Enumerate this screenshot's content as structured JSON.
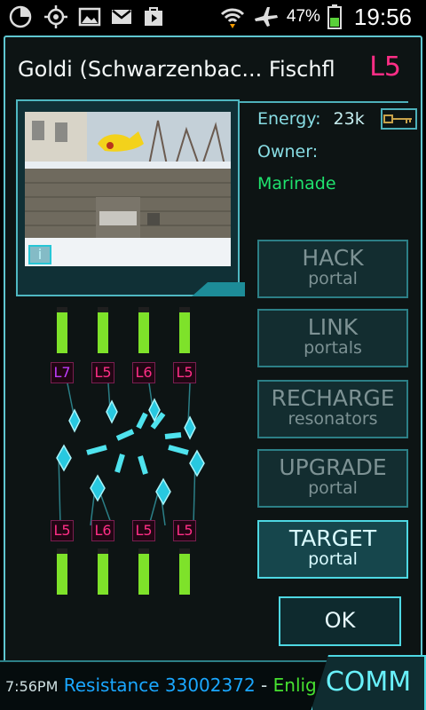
{
  "statusbar": {
    "battery_percent": "47%",
    "time": "19:56",
    "left_icons": [
      "pie-chart-icon",
      "crosshair-icon",
      "gallery-icon",
      "gmail-icon",
      "play-store-icon"
    ],
    "right_icons": [
      "wifi-icon",
      "airplane-icon",
      "battery-icon"
    ]
  },
  "portal": {
    "title": "Goldi (Schwarzenbac... Fischfl",
    "level": "L5",
    "energy_label": "Energy:",
    "energy_value": "23k",
    "owner_label": "Owner:",
    "owner_name": "Marinade",
    "info_button": "i"
  },
  "resonators": {
    "top": [
      {
        "level": "L7",
        "charge": 1.0,
        "color": "#c13cff"
      },
      {
        "level": "L5",
        "charge": 1.0,
        "color": "#ff2e86"
      },
      {
        "level": "L6",
        "charge": 1.0,
        "color": "#ff2e86"
      },
      {
        "level": "L5",
        "charge": 1.0,
        "color": "#ff2e86"
      }
    ],
    "bottom": [
      {
        "level": "L5",
        "charge": 1.0,
        "color": "#ff2e86"
      },
      {
        "level": "L6",
        "charge": 1.0,
        "color": "#ff2e86"
      },
      {
        "level": "L5",
        "charge": 1.0,
        "color": "#ff2e86"
      },
      {
        "level": "L5",
        "charge": 1.0,
        "color": "#ff2e86"
      }
    ]
  },
  "actions": {
    "hack": {
      "line1": "HACK",
      "line2": "portal"
    },
    "link": {
      "line1": "LINK",
      "line2": "portals"
    },
    "recharge": {
      "line1": "RECHARGE",
      "line2": "resonators"
    },
    "upgrade": {
      "line1": "UPGRADE",
      "line2": "portal"
    },
    "target": {
      "line1": "TARGET",
      "line2": "portal"
    },
    "ok": "OK"
  },
  "bottombar": {
    "time": "7:56PM",
    "faction": "Resistance 33002372",
    "separator": " - ",
    "tail": "Enlig",
    "comm": "COMM"
  },
  "colors": {
    "accent": "#4ed8e3",
    "level_pink": "#ff2e86",
    "owner_green": "#1fe36e",
    "bar_green": "#7ee22a"
  }
}
